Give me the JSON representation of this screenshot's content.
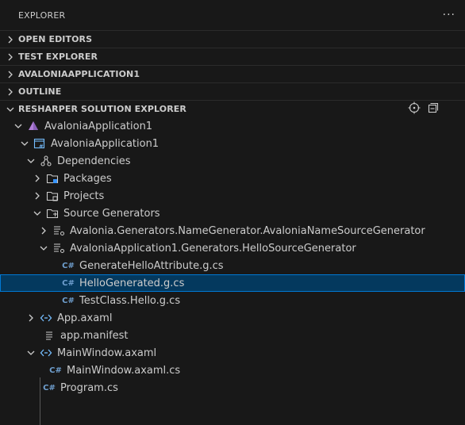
{
  "header": {
    "title": "EXPLORER",
    "more": "···"
  },
  "sections": [
    {
      "label": "OPEN EDITORS"
    },
    {
      "label": "TEST EXPLORER"
    },
    {
      "label": "AVALONIAAPPLICATION1"
    },
    {
      "label": "OUTLINE"
    },
    {
      "label": "RESHARPER SOLUTION EXPLORER"
    }
  ],
  "tree": {
    "solution": "AvaloniaApplication1",
    "project": "AvaloniaApplication1",
    "dependencies": "Dependencies",
    "packages": "Packages",
    "projects": "Projects",
    "source_generators": "Source Generators",
    "gen_name": "Avalonia.Generators.NameGenerator.AvaloniaNameSourceGenerator",
    "gen_hello": "AvaloniaApplication1.Generators.HelloSourceGenerator",
    "file_attr": "GenerateHelloAttribute.g.cs",
    "file_hello": "HelloGenerated.g.cs",
    "file_test": "TestClass.Hello.g.cs",
    "app_axaml": "App.axaml",
    "app_manifest": "app.manifest",
    "main_window": "MainWindow.axaml",
    "main_window_cs": "MainWindow.axaml.cs",
    "program_cs": "Program.cs"
  },
  "colors": {
    "accent": "#0078d4",
    "selected_bg": "#04395e",
    "solution_icon": "#b180d7"
  }
}
